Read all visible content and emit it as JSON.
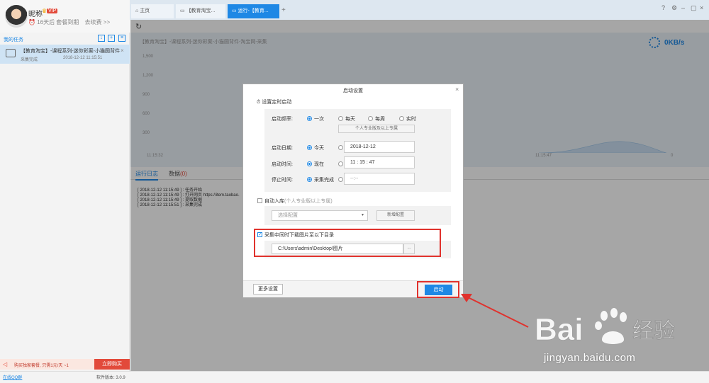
{
  "user": {
    "nickname": "昵称",
    "vip_badge": "VIP",
    "time_info": "16天后 套餐到期",
    "renew_link": "去续费 >>"
  },
  "sidebar": {
    "tasks_title": "我的任务",
    "task": {
      "title": "【教育淘宝】-课程系列-迷你彩案-小猫圆背件",
      "status": "采集完成",
      "time": "2018-12-12 11:15:51"
    },
    "promo_text": "购买独家套餐, 只需1元/天 ~1",
    "promo_button": "立即购买",
    "qq_link": "在线QQ群",
    "version": "软件版本: 3.0.9"
  },
  "tabs": {
    "home": "主页",
    "edu": "【教育淘宝...",
    "run": "运行-【教育..."
  },
  "chart": {
    "title": "【教育淘宝】-课程系列-迷你彩案-小猫圆背件-淘宝网-采集",
    "speed": "0KB/s",
    "y_ticks": [
      "1,500",
      "1,200",
      "900",
      "600",
      "300"
    ],
    "x_start": "11:15:32",
    "x_end": "11:15:47",
    "x_zero": "0"
  },
  "log": {
    "tab_log": "运行日志",
    "tab_data": "数据",
    "tab_data_count": "(0)",
    "lines": [
      "[ 2018-12-12 11:15:49 ] : 任务开始",
      "[ 2018-12-12 11:15:49 ] : 打开网页 https://item.taobao.",
      "[ 2018-12-12 11:15:49 ] : 提取数据",
      "[ 2018-12-12 11:15:51 ] : 采集完成"
    ]
  },
  "dialog": {
    "title": "启动设置",
    "schedule_label": "设置定时启动",
    "frequency_label": "启动频率:",
    "freq_options": [
      "一次",
      "每天",
      "每周",
      "实时"
    ],
    "pro_note": "个人专业版及以上专属",
    "date_label": "启动日期:",
    "date_today": "今天",
    "date_value": "2018-12-12",
    "time_label": "启动时间:",
    "time_now": "现在",
    "time_value": "11 : 15 : 47",
    "stop_label": "停止时间:",
    "stop_done": "采集完成",
    "stop_value": "--:--",
    "auto_store_label": "自动入库",
    "auto_store_note": "(个人专业版以上专属)",
    "config_placeholder": "选择配置",
    "new_config_button": "新增配置",
    "download_label": "采集中同时下载图片至以下目录",
    "download_path": "C:\\Users\\admin\\Desktop\\图片",
    "browse_button": "...",
    "more_settings": "更多设置",
    "start_button": "启动"
  },
  "watermark": {
    "logo_text": "Bai",
    "logo_text2": "经验",
    "url": "jingyan.baidu.com"
  },
  "colors": {
    "accent": "#1e88e5",
    "highlight": "#e0322d"
  }
}
